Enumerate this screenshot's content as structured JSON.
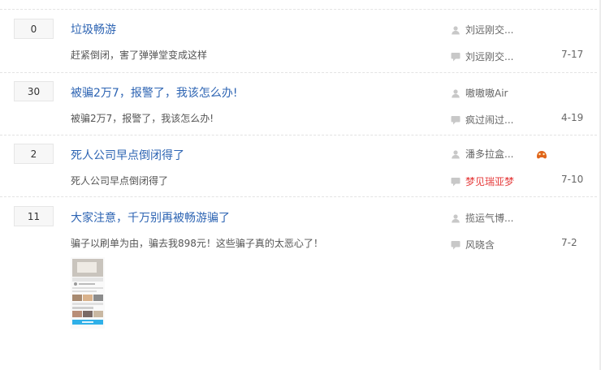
{
  "threads": [
    {
      "reply_count": "0",
      "title": "垃圾畅游",
      "excerpt": "赶紧倒闭，害了弹弹堂变成这样",
      "author": "刘远刚交...",
      "last_reply_user": "刘远刚交...",
      "last_reply_date": "7-17"
    },
    {
      "reply_count": "30",
      "title": "被骗2万7，报警了，我该怎么办!",
      "excerpt": "被骗2万7，报警了，我该怎么办!",
      "author": "嗷嗷嗷Air",
      "last_reply_user": "疯过闹过...",
      "last_reply_date": "4-19"
    },
    {
      "reply_count": "2",
      "title": "死人公司早点倒闭得了",
      "excerpt": "死人公司早点倒闭得了",
      "author": "潘多拉盒...",
      "last_reply_user": "梦见瑞亚梦",
      "last_reply_date": "7-10"
    },
    {
      "reply_count": "11",
      "title": "大家注意，千万别再被畅游骗了",
      "excerpt": "骗子以刷单为由，骗去我898元！这些骗子真的太恶心了！",
      "author": "揽运气博...",
      "last_reply_user": "风晓含",
      "last_reply_date": "7-2"
    }
  ],
  "colors": {
    "title_link": "#2d64b3",
    "highlight_user": "#e53b3b",
    "count_bg": "#f7f7f7"
  },
  "icons": {
    "author": "user-icon",
    "last_reply": "comment-icon",
    "badge": "game-badge-icon"
  }
}
